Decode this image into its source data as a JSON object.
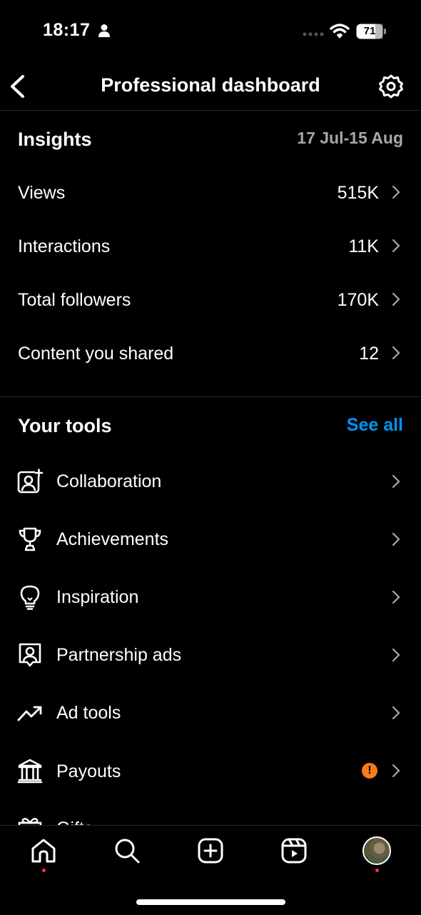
{
  "status_bar": {
    "time": "18:17",
    "battery": "71"
  },
  "header": {
    "title": "Professional dashboard"
  },
  "insights": {
    "title": "Insights",
    "date_range": "17 Jul-15 Aug",
    "rows": [
      {
        "label": "Views",
        "value": "515K"
      },
      {
        "label": "Interactions",
        "value": "11K"
      },
      {
        "label": "Total followers",
        "value": "170K"
      },
      {
        "label": "Content you shared",
        "value": "12"
      }
    ]
  },
  "tools": {
    "title": "Your tools",
    "see_all": "See all",
    "items": [
      {
        "label": "Collaboration",
        "icon": "collaboration-icon"
      },
      {
        "label": "Achievements",
        "icon": "trophy-icon"
      },
      {
        "label": "Inspiration",
        "icon": "lightbulb-icon"
      },
      {
        "label": "Partnership ads",
        "icon": "partnership-icon"
      },
      {
        "label": "Ad tools",
        "icon": "trend-icon"
      },
      {
        "label": "Payouts",
        "icon": "bank-icon",
        "badge": "!"
      },
      {
        "label": "Gifts",
        "icon": "gift-icon"
      }
    ]
  },
  "colors": {
    "accent": "#0095f6",
    "warning": "#f77b1a",
    "notification": "#ff3040"
  }
}
